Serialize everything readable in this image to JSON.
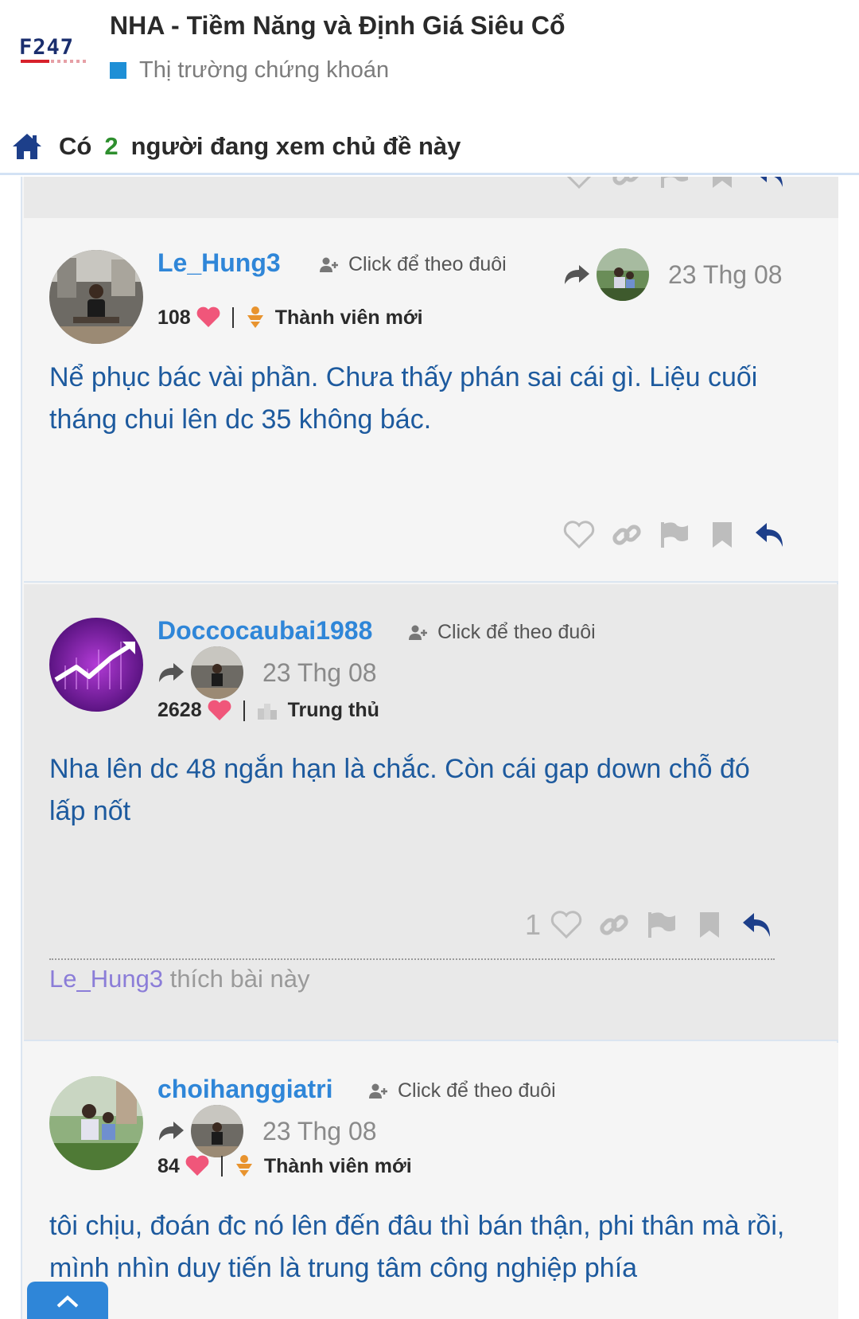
{
  "header": {
    "logo_text": "F247",
    "thread_title": "NHA - Tiềm Năng và Định Giá Siêu Cổ",
    "forum_name": "Thị trường chứng khoán",
    "forum_color": "#1e8fd6"
  },
  "viewers": {
    "prefix": "Có",
    "count": "2",
    "suffix": "người đang xem chủ đề này"
  },
  "posts": [
    {
      "username": "Le_Hung3",
      "follow_label": "Click để theo đuôi",
      "date": "23 Thg 08",
      "reputation": "108",
      "rank": "Thành viên mới",
      "rank_icon": "newbie-icon",
      "body": "Nể phục bác vài phần. Chưa thấy phán sai cái gì. Liệu cuối tháng chui lên dc 35 không bác.",
      "like_count": ""
    },
    {
      "username": "Doccocaubai1988",
      "follow_label": "Click để theo đuôi",
      "date": "23 Thg 08",
      "reputation": "2628",
      "rank": "Trung thủ",
      "rank_icon": "building-icon",
      "body": "Nha lên dc 48 ngắn hạn là chắc. Còn cái gap down chỗ đó lấp nốt",
      "like_count": "1",
      "likers": {
        "name": "Le_Hung3",
        "text": "thích bài này"
      }
    },
    {
      "username": "choihanggiatri",
      "follow_label": "Click để theo đuôi",
      "date": "23 Thg 08",
      "reputation": "84",
      "rank": "Thành viên mới",
      "rank_icon": "newbie-icon",
      "body": "tôi chịu, đoán đc nó lên đến đâu thì bán thận, phi thân mà rồi, mình nhìn duy tiến là trung tâm công nghiệp phía",
      "like_count": ""
    }
  ],
  "colors": {
    "username": "#2f86d8",
    "body_text": "#1d5a9e",
    "reply_icon": "#1d3f8a",
    "heart": "#f0567a"
  }
}
